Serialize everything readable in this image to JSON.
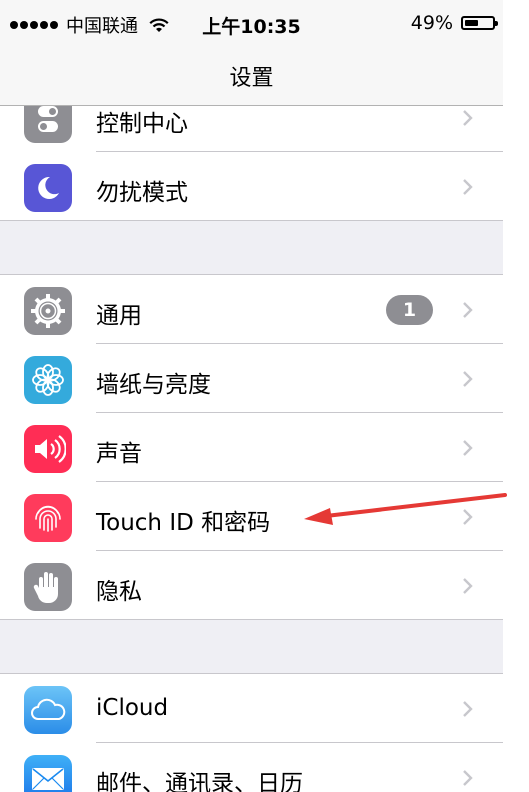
{
  "status_bar": {
    "carrier": "中国联通",
    "time": "上午10:35",
    "battery_percent": "49%",
    "battery_level": 0.49,
    "signal_dots": 5
  },
  "nav": {
    "title": "设置"
  },
  "groups": [
    {
      "rows": [
        {
          "label": "控制中心",
          "icon": "control-center-icon",
          "color": "#8e8e93"
        },
        {
          "label": "勿扰模式",
          "icon": "moon-icon",
          "color": "#5856d6"
        }
      ]
    },
    {
      "rows": [
        {
          "label": "通用",
          "icon": "gear-icon",
          "color": "#8e8e93",
          "badge": "1"
        },
        {
          "label": "墙纸与亮度",
          "icon": "flower-icon",
          "color": "#34aadc"
        },
        {
          "label": "声音",
          "icon": "speaker-icon",
          "color": "#ff2d55"
        },
        {
          "label": "Touch ID 和密码",
          "icon": "fingerprint-icon",
          "color": "#ff3b5c"
        },
        {
          "label": "隐私",
          "icon": "hand-icon",
          "color": "#8e8e93"
        }
      ]
    },
    {
      "rows": [
        {
          "label": "iCloud",
          "icon": "cloud-icon",
          "color": "#4aa8f0"
        },
        {
          "label": "邮件、通讯录、日历",
          "icon": "mail-icon",
          "color": "#1e88f0"
        }
      ]
    }
  ],
  "annotation": {
    "arrow_color": "#e53935"
  }
}
